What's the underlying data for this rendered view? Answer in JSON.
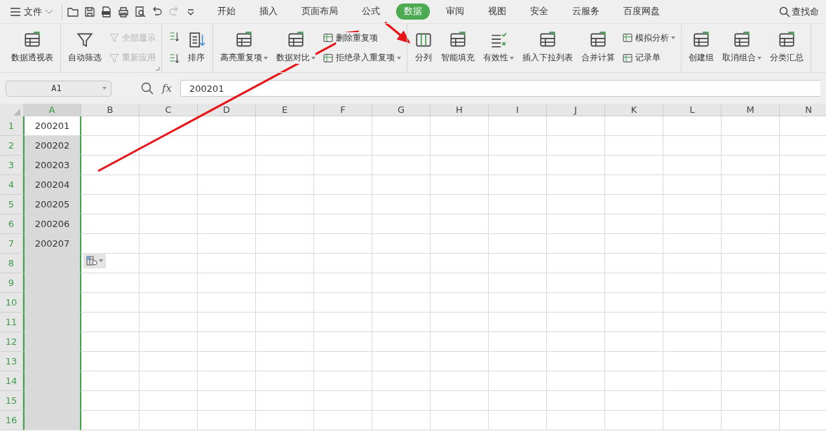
{
  "menu": {
    "file_label": "文件",
    "tabs": [
      {
        "label": "开始",
        "selected": false
      },
      {
        "label": "插入",
        "selected": false
      },
      {
        "label": "页面布局",
        "selected": false
      },
      {
        "label": "公式",
        "selected": false
      },
      {
        "label": "数据",
        "selected": true
      },
      {
        "label": "审阅",
        "selected": false
      },
      {
        "label": "视图",
        "selected": false
      },
      {
        "label": "安全",
        "selected": false
      },
      {
        "label": "云服务",
        "selected": false
      },
      {
        "label": "百度网盘",
        "selected": false
      }
    ],
    "search_label": "查找命"
  },
  "ribbon": {
    "groups": [
      {
        "items": [
          {
            "kind": "large",
            "label": "数据透视表",
            "disabled": false,
            "dropdown": false
          }
        ]
      },
      {
        "items": [
          {
            "kind": "large",
            "label": "自动筛选",
            "disabled": false,
            "dropdown": false
          },
          {
            "kind": "small",
            "label": "全部显示",
            "disabled": true,
            "dropdown": false
          },
          {
            "kind": "small",
            "label": "重新应用",
            "disabled": true,
            "dropdown": false
          }
        ]
      },
      {
        "items": [
          {
            "kind": "sort",
            "disabled": false
          },
          {
            "kind": "large",
            "label": "排序",
            "disabled": false,
            "dropdown": false
          }
        ]
      },
      {
        "items": [
          {
            "kind": "large",
            "label": "高亮重复项",
            "disabled": false,
            "dropdown": true
          },
          {
            "kind": "large",
            "label": "数据对比",
            "disabled": false,
            "dropdown": true
          },
          {
            "kind": "small",
            "label": "删除重复项",
            "disabled": false,
            "dropdown": false
          },
          {
            "kind": "small",
            "label": "拒绝录入重复项",
            "disabled": false,
            "dropdown": true
          }
        ]
      },
      {
        "items": [
          {
            "kind": "large",
            "label": "分列",
            "disabled": false,
            "dropdown": false
          },
          {
            "kind": "large",
            "label": "智能填充",
            "disabled": false,
            "dropdown": false
          },
          {
            "kind": "large",
            "label": "有效性",
            "disabled": false,
            "dropdown": true
          },
          {
            "kind": "large",
            "label": "插入下拉列表",
            "disabled": false,
            "dropdown": false
          },
          {
            "kind": "large",
            "label": "合并计算",
            "disabled": false,
            "dropdown": false
          },
          {
            "kind": "small",
            "label": "模拟分析",
            "disabled": false,
            "dropdown": true
          },
          {
            "kind": "small",
            "label": "记录单",
            "disabled": false,
            "dropdown": false
          }
        ]
      },
      {
        "items": [
          {
            "kind": "large",
            "label": "创建组",
            "disabled": false,
            "dropdown": false
          },
          {
            "kind": "large",
            "label": "取消组合",
            "disabled": false,
            "dropdown": true
          },
          {
            "kind": "large",
            "label": "分类汇总",
            "disabled": false,
            "dropdown": false
          }
        ]
      }
    ]
  },
  "formula_bar": {
    "name_box": "A1",
    "fx_label": "fx",
    "formula": "200201"
  },
  "sheet": {
    "columns": [
      {
        "label": "A",
        "selected": true
      },
      {
        "label": "B",
        "selected": false
      },
      {
        "label": "C",
        "selected": false
      },
      {
        "label": "D",
        "selected": false
      },
      {
        "label": "E",
        "selected": false
      },
      {
        "label": "F",
        "selected": false
      },
      {
        "label": "G",
        "selected": false
      },
      {
        "label": "H",
        "selected": false
      },
      {
        "label": "I",
        "selected": false
      },
      {
        "label": "J",
        "selected": false
      },
      {
        "label": "K",
        "selected": false
      },
      {
        "label": "L",
        "selected": false
      },
      {
        "label": "M",
        "selected": false
      },
      {
        "label": "N",
        "selected": false
      }
    ],
    "rows": [
      {
        "number": "1",
        "cells": [
          "200201"
        ]
      },
      {
        "number": "2",
        "cells": [
          "200202"
        ]
      },
      {
        "number": "3",
        "cells": [
          "200203"
        ]
      },
      {
        "number": "4",
        "cells": [
          "200204"
        ]
      },
      {
        "number": "5",
        "cells": [
          "200205"
        ]
      },
      {
        "number": "6",
        "cells": [
          "200206"
        ]
      },
      {
        "number": "7",
        "cells": [
          "200207"
        ]
      },
      {
        "number": "8",
        "cells": []
      },
      {
        "number": "9",
        "cells": []
      },
      {
        "number": "10",
        "cells": []
      },
      {
        "number": "11",
        "cells": []
      },
      {
        "number": "12",
        "cells": []
      },
      {
        "number": "13",
        "cells": []
      },
      {
        "number": "14",
        "cells": []
      },
      {
        "number": "15",
        "cells": []
      },
      {
        "number": "16",
        "cells": []
      }
    ]
  }
}
